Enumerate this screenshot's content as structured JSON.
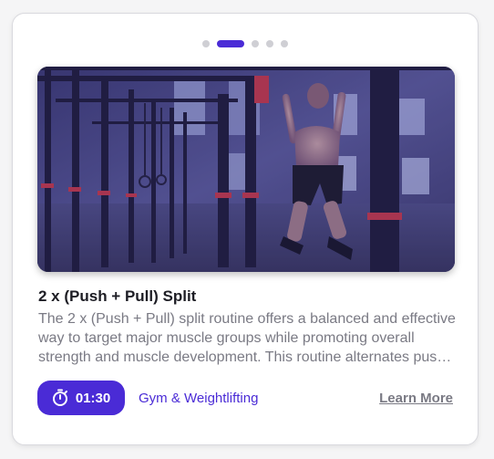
{
  "pager": {
    "count": 5,
    "active_index": 1
  },
  "hero": {
    "icon": "gym-pullup-photo"
  },
  "card": {
    "title": "2 x (Push + Pull) Split",
    "description": "The 2 x (Push + Pull) split routine offers a balanced and effective way to target major muscle groups while promoting overall strength and muscle development. This routine alternates push and pull days.",
    "duration": "01:30",
    "duration_icon": "stopwatch-icon",
    "category": "Gym & Weightlifting",
    "cta_label": "Learn More"
  },
  "colors": {
    "accent": "#4a2bd6",
    "text_primary": "#1d1d24",
    "text_muted": "#7a7a84"
  }
}
